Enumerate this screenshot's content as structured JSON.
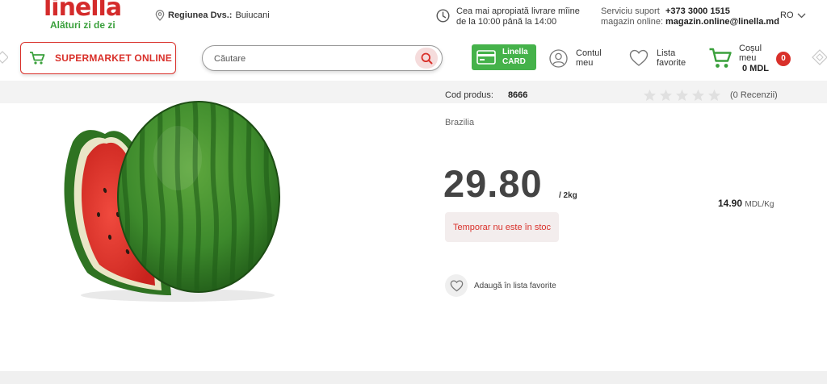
{
  "brand": {
    "name": "linella",
    "tagline": "Alături zi de zi",
    "colors": {
      "red": "#d9302a",
      "green": "#45b24a"
    }
  },
  "header": {
    "region_label": "Regiunea Dvs.:",
    "region_value": "Buiucani",
    "delivery_line1": "Cea mai apropiată livrare mîine",
    "delivery_line2": "de la 10:00 până la 14:00",
    "support_label1": "Serviciu suport",
    "support_label2": "magazin online:",
    "support_phone": "+373 3000 1515",
    "support_email": "magazin.online@linella.md",
    "language": "RO"
  },
  "nav": {
    "supermarket_label": "SUPERMARKET ONLINE",
    "search_placeholder": "Căutare",
    "card_line1": "Linella",
    "card_line2": "CARD",
    "account_line1": "Contul",
    "account_line2": "meu",
    "favorites_line1": "Lista",
    "favorites_line2": "favorite",
    "cart_line1": "Coșul",
    "cart_line2": "meu",
    "cart_total": "0 MDL",
    "cart_count": "0"
  },
  "product": {
    "image_icon": "watermelon-image",
    "code_label": "Cod produs:",
    "code_value": "8666",
    "rating": 0,
    "reviews": "(0 Recenzii)",
    "origin": "Brazilia",
    "price": "29.80",
    "unit": "/ 2kg",
    "price_per_kg_value": "14.90",
    "price_per_kg_unit": "MDL/Kg",
    "stock_status": "Temporar nu este în stoc",
    "add_favorites": "Adaugă în lista favorite"
  }
}
